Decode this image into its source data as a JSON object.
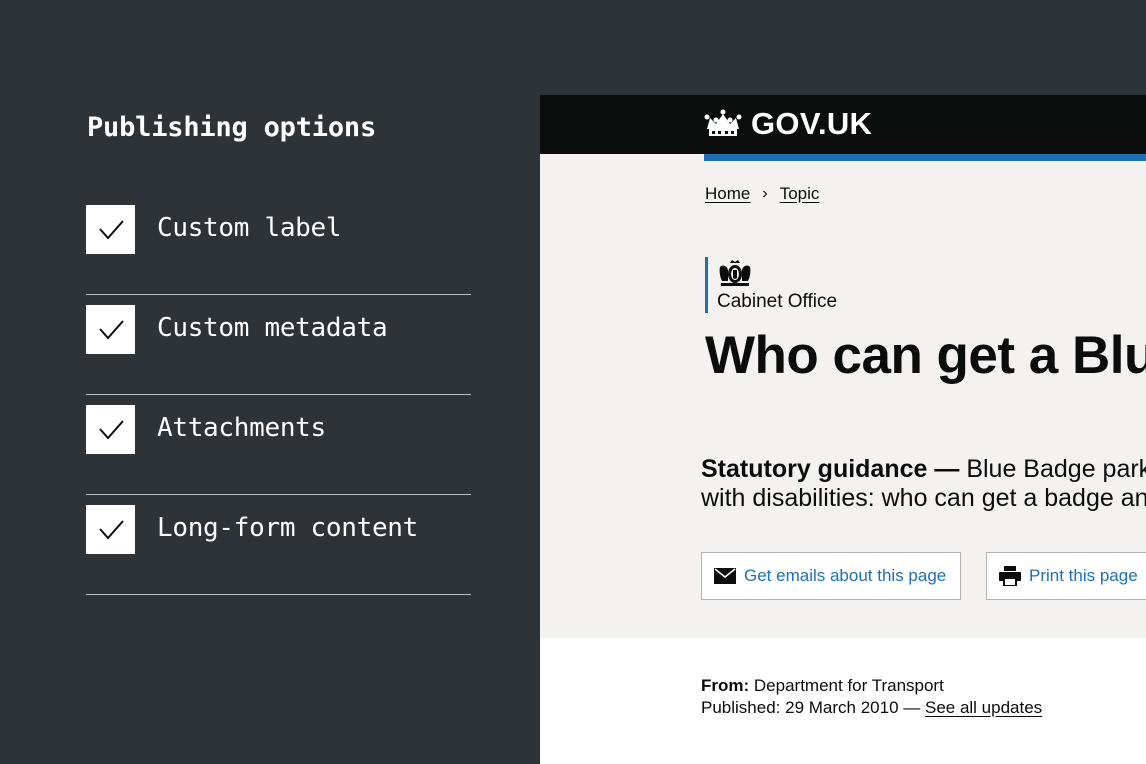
{
  "panel": {
    "title": "Publishing options",
    "options": [
      {
        "label": "Custom label",
        "checked": true
      },
      {
        "label": "Custom metadata",
        "checked": true
      },
      {
        "label": "Attachments",
        "checked": true
      },
      {
        "label": "Long-form content",
        "checked": true
      }
    ]
  },
  "govuk": {
    "logo_text": "GOV.UK",
    "breadcrumb": [
      "Home",
      "Topic"
    ],
    "organisation": "Cabinet Office",
    "title": "Who can get a Blue",
    "summary": {
      "type": "Statutory guidance —",
      "line1": " Blue Badge park",
      "line2": "with disabilities: who can get a badge an"
    },
    "actions": {
      "email": "Get emails about this page",
      "print": "Print this page"
    },
    "meta": {
      "from_label": "From:",
      "from_value": "Department for Transport",
      "published": "Published: 29 March 2010 —",
      "see_all": "See all updates"
    }
  },
  "colors": {
    "panel_bg": "#2e3337",
    "header_bg": "#0b0c0c",
    "brand_blue": "#1d70b8",
    "hero_bg": "#f3f2f1"
  }
}
